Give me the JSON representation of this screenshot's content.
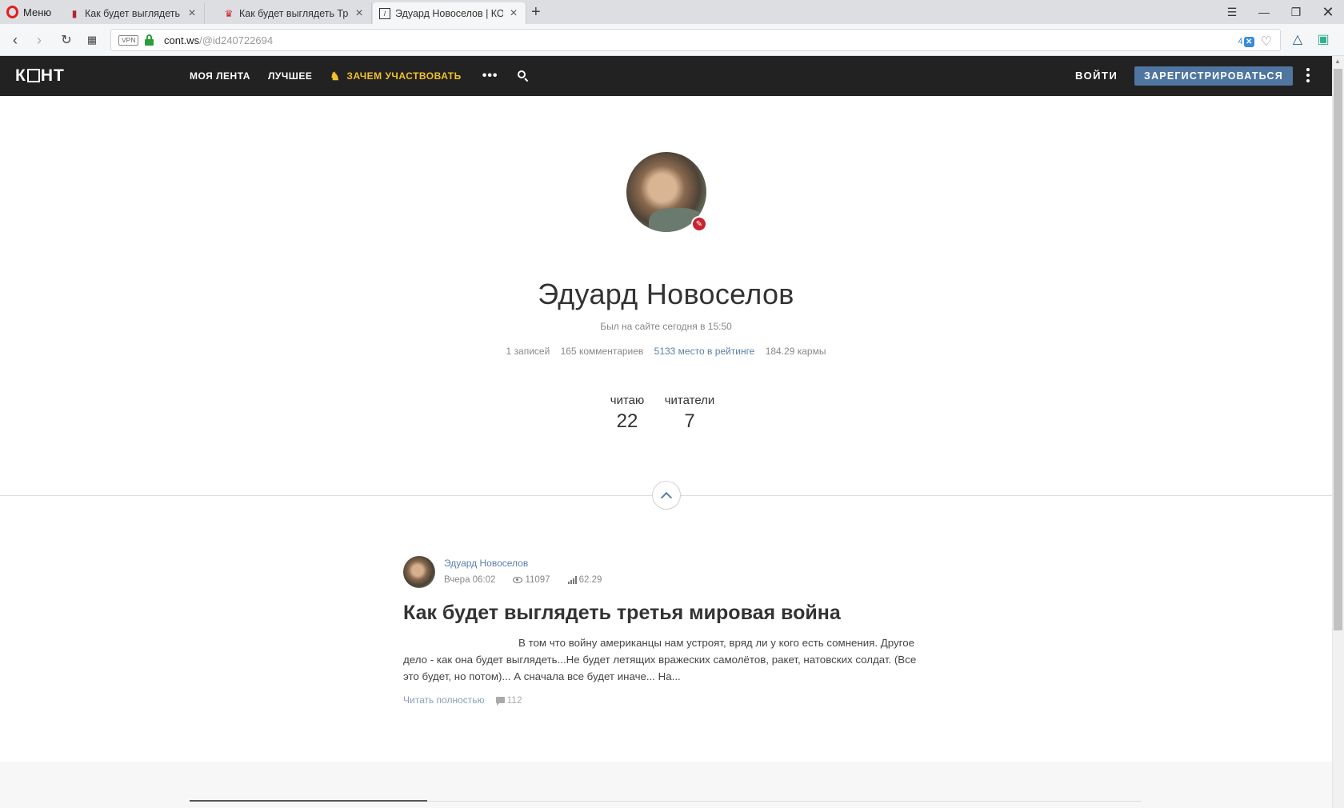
{
  "browser": {
    "menu_label": "Меню",
    "tabs": [
      {
        "title": "Как будет выглядеть вой"
      },
      {
        "title": "Как будет выглядеть Трет"
      },
      {
        "title": "Эдуард Новоселов | КОН"
      }
    ],
    "url_host": "cont.ws",
    "url_path": "/@id240722694",
    "vpn_label": "VPN",
    "ext_badge_count": "4"
  },
  "site": {
    "logo": {
      "left": "К",
      "right": "НТ"
    },
    "menu": {
      "my_feed": "МОЯ ЛЕНТА",
      "best": "ЛУЧШЕЕ",
      "why_participate": "ЗАЧЕМ УЧАСТВОВАТЬ",
      "more": "•••"
    },
    "login": "ВОЙТИ",
    "register": "ЗАРЕГИСТРИРОВАТЬСЯ",
    "colors": {
      "navbar": "#222222",
      "accent_gold": "#f2c12e",
      "button_blue": "#4f76a0",
      "link": "#5b7fa6"
    }
  },
  "profile": {
    "name": "Эдуард Новоселов",
    "last_seen": "Был на сайте сегодня в 15:50",
    "stats": {
      "posts": "1 записей",
      "comments": "165 комментариев",
      "rank": "5133 место в рейтинге",
      "karma": "184.29 кармы"
    },
    "following_label": "читаю",
    "following_count": "22",
    "followers_label": "читатели",
    "followers_count": "7"
  },
  "post": {
    "author": "Эдуард Новоселов",
    "date": "Вчера 06:02",
    "views": "11097",
    "rating": "62.29",
    "title": "Как будет выглядеть третья мировая война",
    "excerpt": "В том что войну американцы нам устроят, вряд ли у кого есть сомнения. Другое дело - как она будет выглядеть...Не будет летящих вражеских самолётов, ракет, натовских солдат. (Все это будет, но потом)... А сначала все будет иначе... На...",
    "read_more": "Читать полностью",
    "comments": "112"
  }
}
